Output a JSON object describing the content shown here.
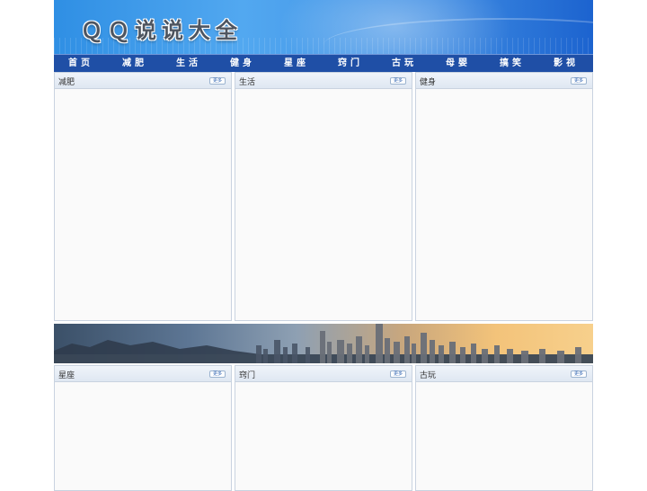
{
  "header": {
    "site_title": "ＱＱ说说大全"
  },
  "nav": {
    "items": [
      {
        "label": "首页"
      },
      {
        "label": "减肥"
      },
      {
        "label": "生活"
      },
      {
        "label": "健身"
      },
      {
        "label": "星座"
      },
      {
        "label": "窍门"
      },
      {
        "label": "古玩"
      },
      {
        "label": "母婴"
      },
      {
        "label": "搞笑"
      },
      {
        "label": "影视"
      }
    ]
  },
  "panels_top": [
    {
      "title": "减肥",
      "more_label": "更多"
    },
    {
      "title": "生活",
      "more_label": "更多"
    },
    {
      "title": "健身",
      "more_label": "更多"
    }
  ],
  "panels_bottom": [
    {
      "title": "星座",
      "more_label": "更多"
    },
    {
      "title": "窍门",
      "more_label": "更多"
    },
    {
      "title": "古玩",
      "more_label": "更多"
    }
  ],
  "colors": {
    "nav_bg": "#1f4fa6",
    "header_blue": "#3f8de3",
    "panel_border": "#c9d3e0"
  }
}
